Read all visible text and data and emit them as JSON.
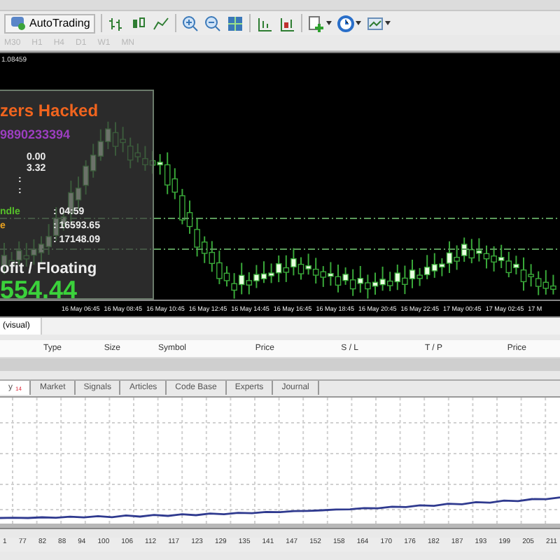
{
  "toolbar": {
    "autotrading": "AutoTrading",
    "timeframes": [
      "M30",
      "H1",
      "H4",
      "D1",
      "W1",
      "MN"
    ]
  },
  "chart": {
    "price_label": "1.08459",
    "overlay": [
      {
        "kind": "title",
        "value": "zers Hacked"
      },
      {
        "kind": "account",
        "value": "9890233394"
      },
      {
        "kind": "short",
        "value": "0.00"
      },
      {
        "kind": "short",
        "value": "3.32"
      },
      {
        "kind": "colon",
        "value": ":"
      },
      {
        "kind": "colon",
        "value": ":"
      },
      {
        "kind": "row",
        "label": "ndle",
        "color": "#56c02a",
        "value": ": 04:59"
      },
      {
        "kind": "row",
        "label": "e",
        "color": "#e8a020",
        "value": ": 16593.65"
      },
      {
        "kind": "row",
        "value": ": 17148.09"
      },
      {
        "kind": "heading",
        "value": "ofit / Floating"
      },
      {
        "kind": "big",
        "value": "554.44"
      }
    ],
    "time_axis": [
      "16 May 06:45",
      "16 May 08:45",
      "16 May 10:45",
      "16 May 12:45",
      "16 May 14:45",
      "16 May 16:45",
      "16 May 18:45",
      "16 May 20:45",
      "16 May 22:45",
      "17 May 00:45",
      "17 May 02:45",
      "17 M"
    ]
  },
  "trade_panel": {
    "tab": "(visual)",
    "columns": [
      "Type",
      "Size",
      "Symbol",
      "Price",
      "S / L",
      "T / P",
      "Price"
    ]
  },
  "terminal_tabs": [
    {
      "label": "y",
      "badge": "14",
      "selected": true
    },
    {
      "label": "Market",
      "selected": false
    },
    {
      "label": "Signals",
      "selected": false
    },
    {
      "label": "Articles",
      "selected": false
    },
    {
      "label": "Code Base",
      "selected": false
    },
    {
      "label": "Experts",
      "selected": false
    },
    {
      "label": "Journal",
      "selected": false
    }
  ],
  "graph": {
    "x_labels": [
      "1",
      "77",
      "82",
      "88",
      "94",
      "100",
      "106",
      "112",
      "117",
      "123",
      "129",
      "135",
      "141",
      "147",
      "152",
      "158",
      "164",
      "170",
      "176",
      "182",
      "187",
      "193",
      "199",
      "205",
      "211"
    ]
  }
}
